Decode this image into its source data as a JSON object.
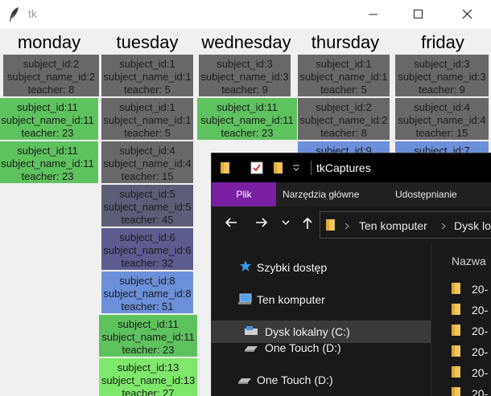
{
  "tk_window": {
    "title": "tk",
    "days": [
      "monday",
      "tuesday",
      "wednesday",
      "thursday",
      "friday"
    ],
    "columns": [
      [
        {
          "subject_id": "subject_id:2",
          "subject_name_id": "subject_name_id:2",
          "teacher": "teacher: 8",
          "color": "#686868"
        },
        {
          "subject_id": "subject_id:11",
          "subject_name_id": "subject_name_id:11",
          "teacher": "teacher: 23",
          "color": "#5ec25e"
        },
        {
          "subject_id": "subject_id:11",
          "subject_name_id": "subject_name_id:11",
          "teacher": "teacher: 23",
          "color": "#5ec25e"
        }
      ],
      [
        {
          "subject_id": "subject_id:1",
          "subject_name_id": "subject_name_id:1",
          "teacher": "teacher: 5",
          "color": "#686868"
        },
        {
          "subject_id": "subject_id:1",
          "subject_name_id": "subject_name_id:1",
          "teacher": "teacher: 5",
          "color": "#686868"
        },
        {
          "subject_id": "subject_id:4",
          "subject_name_id": "subject_name_id:4",
          "teacher": "teacher: 15",
          "color": "#686868"
        },
        {
          "subject_id": "subject_id:5",
          "subject_name_id": "subject_name_id:5",
          "teacher": "teacher: 45",
          "color": "#5c5e78"
        },
        {
          "subject_id": "subject_id:6",
          "subject_name_id": "subject_name_id:6",
          "teacher": "teacher: 32",
          "color": "#5d5c8f"
        },
        {
          "subject_id": "subject_id:8",
          "subject_name_id": "subject_name_id:8",
          "teacher": "teacher: 51",
          "color": "#6b8fd9"
        },
        {
          "subject_id": "subject_id:11",
          "subject_name_id": "subject_name_id:11",
          "teacher": "teacher: 23",
          "color": "#5ec25e"
        },
        {
          "subject_id": "subject_id:13",
          "subject_name_id": "subject_name_id:13",
          "teacher": "teacher: 27",
          "color": "#7ee86a"
        }
      ],
      [
        {
          "subject_id": "subject_id:3",
          "subject_name_id": "subject_name_id:3",
          "teacher": "teacher: 9",
          "color": "#686868"
        },
        {
          "subject_id": "subject_id:11",
          "subject_name_id": "subject_name_id:11",
          "teacher": "teacher: 23",
          "color": "#5ec25e"
        }
      ],
      [
        {
          "subject_id": "subject_id:1",
          "subject_name_id": "subject_name_id:1",
          "teacher": "teacher: 5",
          "color": "#686868"
        },
        {
          "subject_id": "subject_id:2",
          "subject_name_id": "subject_name_id:2",
          "teacher": "teacher: 8",
          "color": "#686868"
        },
        {
          "subject_id": "subject_id:9",
          "subject_name_id": "",
          "teacher": "",
          "color": "#6b8fd9"
        }
      ],
      [
        {
          "subject_id": "subject_id:3",
          "subject_name_id": "subject_name_id:3",
          "teacher": "teacher: 9",
          "color": "#686868"
        },
        {
          "subject_id": "subject_id:4",
          "subject_name_id": "subject_name_id:4",
          "teacher": "teacher: 15",
          "color": "#686868"
        },
        {
          "subject_id": "subject_id:7",
          "subject_name_id": "",
          "teacher": "",
          "color": "#6b8fd9"
        }
      ]
    ]
  },
  "explorer": {
    "title": "tkCaptures",
    "ribbon_tabs": [
      "Plik",
      "Narzędzia główne",
      "Udostępnianie"
    ],
    "address": [
      "Ten komputer",
      "Dysk lo"
    ],
    "nav_items": [
      "Szybki dostęp",
      "Ten komputer",
      "Dysk lokalny (C:)",
      "One Touch (D:)",
      "One Touch (D:)"
    ],
    "column_header": "Nazwa",
    "folder_labels": [
      "20-",
      "20-",
      "20-",
      "20-",
      "20-",
      "20-"
    ],
    "accent": "#7a1fa2"
  },
  "icons": [
    "feather-icon",
    "minimize-icon",
    "maximize-icon",
    "close-icon",
    "folder-icon",
    "properties-icon",
    "qa-dropdown-icon",
    "back-arrow-icon",
    "forward-arrow-icon",
    "recent-dropdown-icon",
    "up-arrow-icon",
    "star-icon",
    "computer-icon",
    "drive-icon",
    "external-drive-icon"
  ]
}
